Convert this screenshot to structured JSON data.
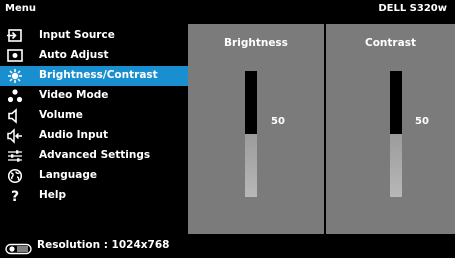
{
  "header": {
    "title": "Menu",
    "model": "DELL S320w"
  },
  "menu": {
    "items": [
      {
        "label": "Input Source",
        "icon": "input-source-icon"
      },
      {
        "label": "Auto Adjust",
        "icon": "auto-adjust-icon"
      },
      {
        "label": "Brightness/Contrast",
        "icon": "brightness-icon",
        "selected": true
      },
      {
        "label": "Video Mode",
        "icon": "video-mode-icon"
      },
      {
        "label": "Volume",
        "icon": "volume-icon"
      },
      {
        "label": "Audio Input",
        "icon": "audio-input-icon"
      },
      {
        "label": "Advanced Settings",
        "icon": "advanced-settings-icon"
      },
      {
        "label": "Language",
        "icon": "language-icon"
      },
      {
        "label": "Help",
        "icon": "help-icon"
      }
    ]
  },
  "brightness": {
    "title": "Brightness",
    "value": "50",
    "level": 0.5
  },
  "contrast": {
    "title": "Contrast",
    "value": "50",
    "level": 0.5
  },
  "status": {
    "label": "Resolution : 1024x768",
    "icon": "projector-icon"
  },
  "colors": {
    "highlight": "#1a8fd0",
    "panel": "#7b7b7b"
  }
}
